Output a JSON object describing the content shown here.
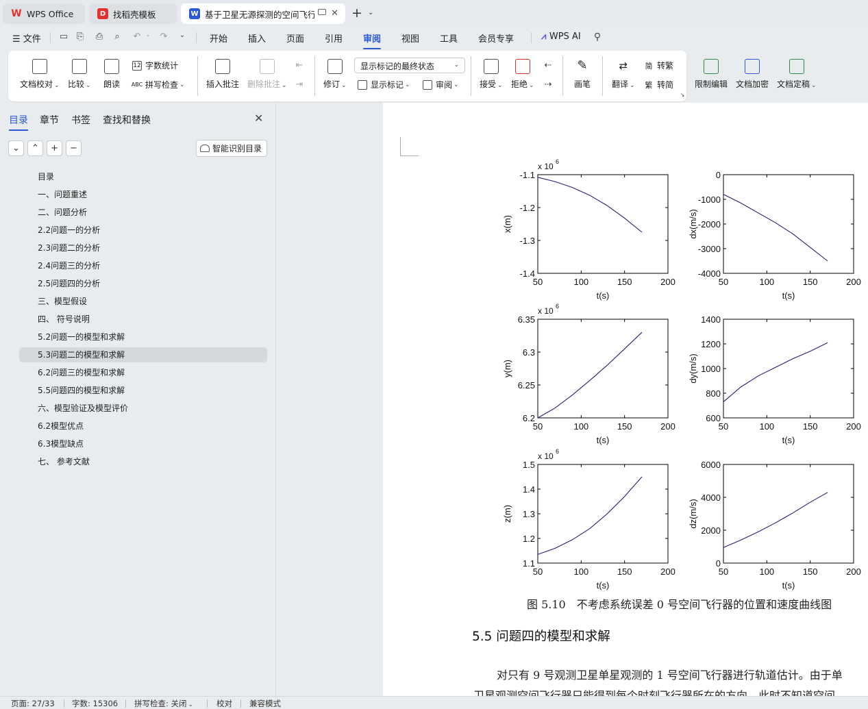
{
  "tabs": [
    {
      "label": "WPS Office",
      "icon": "wps-logo-icon",
      "color": "#e0332d"
    },
    {
      "label": "找稻壳模板",
      "icon": "docer-icon",
      "color": "#e0332d"
    },
    {
      "label": "基于卫星无源探测的空间飞行器",
      "icon": "word-doc-icon",
      "color": "#2c58d6"
    }
  ],
  "menu": {
    "file": "文件",
    "items": [
      "开始",
      "插入",
      "页面",
      "引用",
      "审阅",
      "视图",
      "工具",
      "会员专享"
    ],
    "active": "审阅",
    "wps_ai": "WPS AI"
  },
  "ribbon": {
    "proofread": "文档校对",
    "compare": "比较",
    "read_aloud": "朗读",
    "word_count": "字数统计",
    "spell_check": "拼写检查",
    "insert_comment": "插入批注",
    "delete_comment": "删除批注",
    "track_changes": "修订",
    "markup_state": "显示标记的最终状态",
    "show_markup": "显示标记",
    "review": "审阅",
    "accept": "接受",
    "reject": "拒绝",
    "pen": "画笔",
    "translate": "翻译",
    "to_traditional": "转繁",
    "to_simplified": "转简",
    "restrict_edit": "限制编辑",
    "encrypt": "文档加密",
    "finalize": "文档定稿"
  },
  "nav": {
    "tabs": [
      "目录",
      "章节",
      "书签",
      "查找和替换"
    ],
    "smart_toc": "智能识别目录",
    "toc": [
      "目录",
      "一、问题重述",
      "二、问题分析",
      "2.2问题一的分析",
      "2.3问题二的分析",
      "2.4问题三的分析",
      "2.5问题四的分析",
      "三、模型假设",
      "四、 符号说明",
      "5.2问题一的模型和求解",
      "5.3问题二的模型和求解",
      "6.2问题三的模型和求解",
      "5.5问题四的模型和求解",
      "六、模型验证及模型评价",
      "6.2模型优点",
      "6.3模型缺点",
      "七、 参考文献"
    ],
    "selected_index": 10
  },
  "document": {
    "caption": "图 5.10　不考虑系统误差 0 号空间飞行器的位置和速度曲线图",
    "section_heading": "5.5  问题四的模型和求解",
    "body_lines": [
      "对只有 9 号观测卫星单星观测的 1 号空间飞行器进行轨道估计。由于单",
      "卫星观测空间飞行器只能得到每个时刻飞行器所在的方向，此时不知道空间"
    ]
  },
  "status": {
    "page": "页面: 27/33",
    "words": "字数: 15306",
    "spell": "拼写检查: 关闭",
    "proof": "校对",
    "compat": "兼容模式"
  },
  "chart_data": [
    {
      "type": "line",
      "xlabel": "t(s)",
      "ylabel": "x(m)",
      "exponent_label": "x 10",
      "exponent_sup": "6",
      "xlim": [
        50,
        200
      ],
      "ylim": [
        -1.4,
        -1.1
      ],
      "xticks": [
        50,
        100,
        150,
        200
      ],
      "yticks": [
        -1.1,
        -1.2,
        -1.3,
        -1.4
      ],
      "x": [
        50,
        70,
        90,
        110,
        130,
        150,
        170
      ],
      "y": [
        -1.108,
        -1.121,
        -1.139,
        -1.163,
        -1.194,
        -1.232,
        -1.275
      ],
      "color": "#1f1f7a"
    },
    {
      "type": "line",
      "xlabel": "t(s)",
      "ylabel": "dx(m/s)",
      "xlim": [
        50,
        200
      ],
      "ylim": [
        -4000,
        0
      ],
      "xticks": [
        50,
        100,
        150,
        200
      ],
      "yticks": [
        0,
        -1000,
        -2000,
        -3000,
        -4000
      ],
      "x": [
        50,
        70,
        90,
        110,
        130,
        150,
        170
      ],
      "y": [
        -800,
        -1150,
        -1550,
        -1950,
        -2400,
        -2950,
        -3500
      ],
      "color": "#1f1f7a"
    },
    {
      "type": "line",
      "xlabel": "t(s)",
      "ylabel": "y(m)",
      "exponent_label": "x 10",
      "exponent_sup": "6",
      "xlim": [
        50,
        200
      ],
      "ylim": [
        6.2,
        6.35
      ],
      "xticks": [
        50,
        100,
        150,
        200
      ],
      "yticks": [
        6.35,
        6.3,
        6.25,
        6.2
      ],
      "x": [
        50,
        70,
        90,
        110,
        130,
        150,
        170
      ],
      "y": [
        6.2,
        6.215,
        6.235,
        6.257,
        6.28,
        6.305,
        6.33
      ],
      "color": "#1f1f7a"
    },
    {
      "type": "line",
      "xlabel": "t(s)",
      "ylabel": "dy(m/s)",
      "xlim": [
        50,
        200
      ],
      "ylim": [
        600,
        1400
      ],
      "xticks": [
        50,
        100,
        150,
        200
      ],
      "yticks": [
        1400,
        1200,
        1000,
        800,
        600
      ],
      "x": [
        50,
        70,
        90,
        110,
        130,
        150,
        170
      ],
      "y": [
        730,
        850,
        940,
        1010,
        1080,
        1140,
        1210
      ],
      "color": "#1f1f7a"
    },
    {
      "type": "line",
      "xlabel": "t(s)",
      "ylabel": "z(m)",
      "exponent_label": "x 10",
      "exponent_sup": "6",
      "xlim": [
        50,
        200
      ],
      "ylim": [
        1.1,
        1.5
      ],
      "xticks": [
        50,
        100,
        150,
        200
      ],
      "yticks": [
        1.5,
        1.4,
        1.3,
        1.2,
        1.1
      ],
      "x": [
        50,
        70,
        90,
        110,
        130,
        150,
        170
      ],
      "y": [
        1.135,
        1.16,
        1.195,
        1.24,
        1.3,
        1.37,
        1.45
      ],
      "color": "#1f1f7a"
    },
    {
      "type": "line",
      "xlabel": "t(s)",
      "ylabel": "dz(m/s)",
      "xlim": [
        50,
        200
      ],
      "ylim": [
        0,
        6000
      ],
      "xticks": [
        50,
        100,
        150,
        200
      ],
      "yticks": [
        6000,
        4000,
        2000,
        0
      ],
      "x": [
        50,
        70,
        90,
        110,
        130,
        150,
        170
      ],
      "y": [
        950,
        1400,
        1900,
        2450,
        3050,
        3700,
        4300
      ],
      "color": "#1f1f7a"
    }
  ]
}
